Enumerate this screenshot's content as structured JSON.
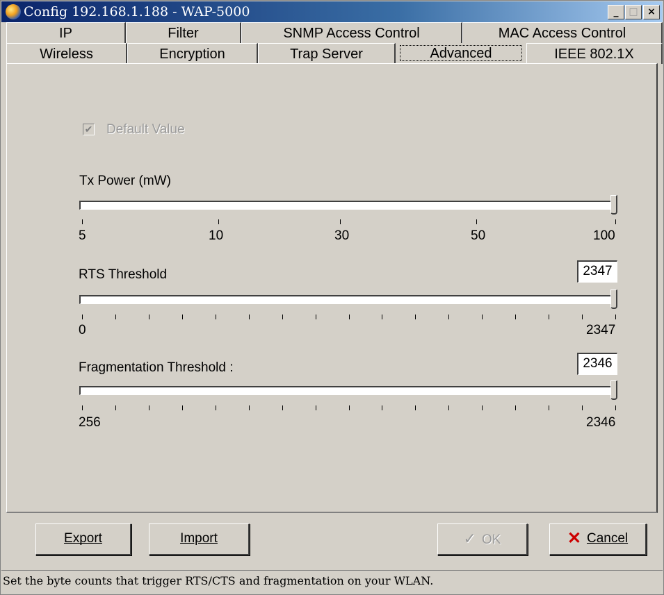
{
  "window": {
    "title": "Config 192.168.1.188 - WAP-5000"
  },
  "tabs": {
    "row_top": [
      "IP",
      "Filter",
      "SNMP Access Control",
      "MAC Access Control"
    ],
    "row_bottom": [
      "Wireless",
      "Encryption",
      "Trap Server",
      "Advanced",
      "IEEE 802.1X"
    ],
    "active": "Advanced"
  },
  "default_value": {
    "label": "Default Value",
    "checked": true,
    "enabled": false
  },
  "tx_power": {
    "label": "Tx Power (mW)",
    "ticks": [
      "5",
      "10",
      "30",
      "50",
      "100"
    ],
    "value": "100",
    "position_fraction": 1.0
  },
  "rts_threshold": {
    "label": "RTS Threshold",
    "value": "2347",
    "min": "0",
    "max": "2347",
    "position_fraction": 1.0
  },
  "frag_threshold": {
    "label": "Fragmentation Threshold :",
    "value": "2346",
    "min": "256",
    "max": "2346",
    "position_fraction": 1.0
  },
  "buttons": {
    "export": "Export",
    "import": "Import",
    "ok": "OK",
    "cancel": "Cancel"
  },
  "status": "Set the byte counts that trigger RTS/CTS and fragmentation on your WLAN.",
  "icons": {
    "app": "app-globe-icon",
    "ok": "checkmark-icon",
    "cancel": "red-x-icon"
  }
}
